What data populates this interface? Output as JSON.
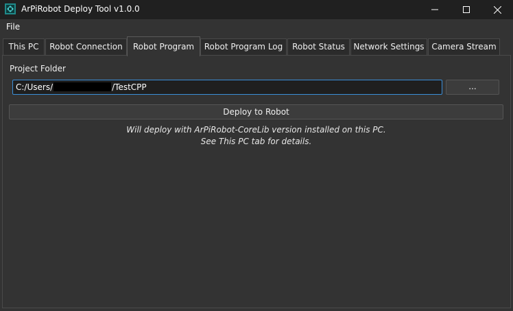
{
  "window": {
    "title": "ArPiRobot Deploy Tool v1.0.0",
    "app_icon": "arpirobot-icon",
    "accent_color": "#3a8fd9"
  },
  "menu": {
    "file_label": "File"
  },
  "tabs": [
    {
      "label": "This PC",
      "active": false
    },
    {
      "label": "Robot Connection",
      "active": false
    },
    {
      "label": "Robot Program",
      "active": true
    },
    {
      "label": "Robot Program Log",
      "active": false
    },
    {
      "label": "Robot Status",
      "active": false
    },
    {
      "label": "Network Settings",
      "active": false
    },
    {
      "label": "Camera Stream",
      "active": false
    }
  ],
  "robot_program": {
    "project_folder_label": "Project Folder",
    "folder_path_prefix": "C:/Users/",
    "folder_path_suffix": "/TestCPP",
    "browse_label": "...",
    "deploy_label": "Deploy to Robot",
    "info_line1": "Will deploy with ArPiRobot-CoreLib version installed on this PC.",
    "info_line2": "See This PC tab for details."
  }
}
